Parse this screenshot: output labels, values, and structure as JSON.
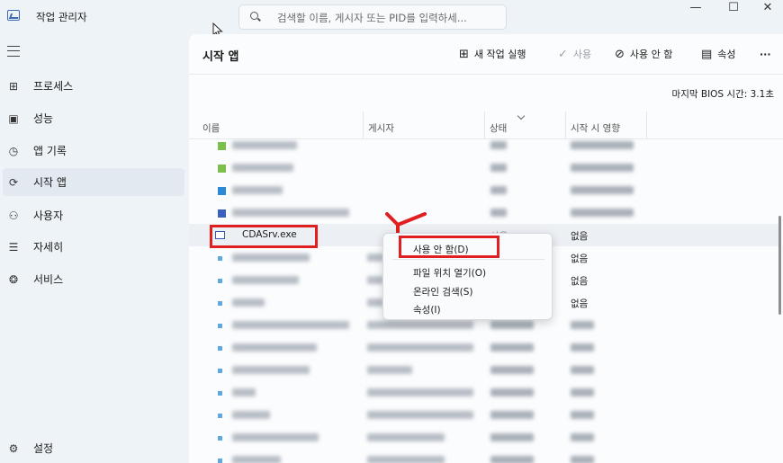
{
  "window": {
    "title": "작업 관리자",
    "search_placeholder": "검색할 이름, 게시자 또는 PID를 입력하세...",
    "controls": {
      "minimize": "—",
      "maximize": "☐",
      "close": "✕"
    }
  },
  "sidebar": {
    "items": [
      {
        "label": "프로세스",
        "icon": "processes-icon",
        "glyph": "⊞"
      },
      {
        "label": "성능",
        "icon": "performance-icon",
        "glyph": "▣"
      },
      {
        "label": "앱 기록",
        "icon": "app-history-icon",
        "glyph": "◷"
      },
      {
        "label": "시작 앱",
        "icon": "startup-apps-icon",
        "glyph": "⟳",
        "active": true
      },
      {
        "label": "사용자",
        "icon": "users-icon",
        "glyph": "⚇"
      },
      {
        "label": "자세히",
        "icon": "details-icon",
        "glyph": "☰"
      },
      {
        "label": "서비스",
        "icon": "services-icon",
        "glyph": "❂"
      }
    ],
    "settings_label": "설정"
  },
  "toolbar": {
    "page_title": "시작 앱",
    "run_new_task": "새 작업 실행",
    "enable": "사용",
    "disable": "사용 안 함",
    "properties": "속성",
    "more": "···"
  },
  "bios_time": "마지막 BIOS 시간: 3.1초",
  "columns": {
    "name": "이름",
    "publisher": "게시자",
    "status": "상태",
    "startup_impact": "시작 시 영향"
  },
  "rows": [
    {
      "icon_color": "#7cbf4a",
      "status": "",
      "impact": ""
    },
    {
      "icon_color": "#7cbf4a",
      "status": "",
      "impact": ""
    },
    {
      "icon_color": "#2a8ad8",
      "status": "",
      "impact": ""
    },
    {
      "icon_color": "#3a5fbf",
      "status": "",
      "impact": ""
    },
    {
      "name": "CDASrv.exe",
      "icon_color": "#2f5fa8",
      "status": "사용",
      "impact": "없음",
      "selected": true
    },
    {
      "icon_color": "#5fa8e0",
      "status": "",
      "impact": "없음"
    },
    {
      "icon_color": "#5fa8e0",
      "status": "",
      "impact": "없음"
    },
    {
      "icon_color": "#5fa8e0",
      "status": "",
      "impact": "없음"
    },
    {
      "icon_color": "#5fa8e0",
      "status": "",
      "impact": ""
    },
    {
      "icon_color": "#5fa8e0",
      "status": "",
      "impact": ""
    },
    {
      "icon_color": "#5fa8e0",
      "status": "",
      "impact": ""
    },
    {
      "icon_color": "#5fa8e0",
      "status": "",
      "impact": ""
    },
    {
      "icon_color": "#5fa8e0",
      "status": "",
      "impact": ""
    },
    {
      "icon_color": "#5fa8e0",
      "status": "",
      "impact": ""
    },
    {
      "icon_color": "#5fa8e0",
      "status": "",
      "impact": ""
    }
  ],
  "context_menu": {
    "disable": "사용 안 함(D)",
    "open_file_location": "파일 위치 열기(O)",
    "search_online": "온라인 검색(S)",
    "properties": "속성(I)"
  },
  "colors": {
    "highlight": "#e02020",
    "accent": "#3d6bb3"
  }
}
